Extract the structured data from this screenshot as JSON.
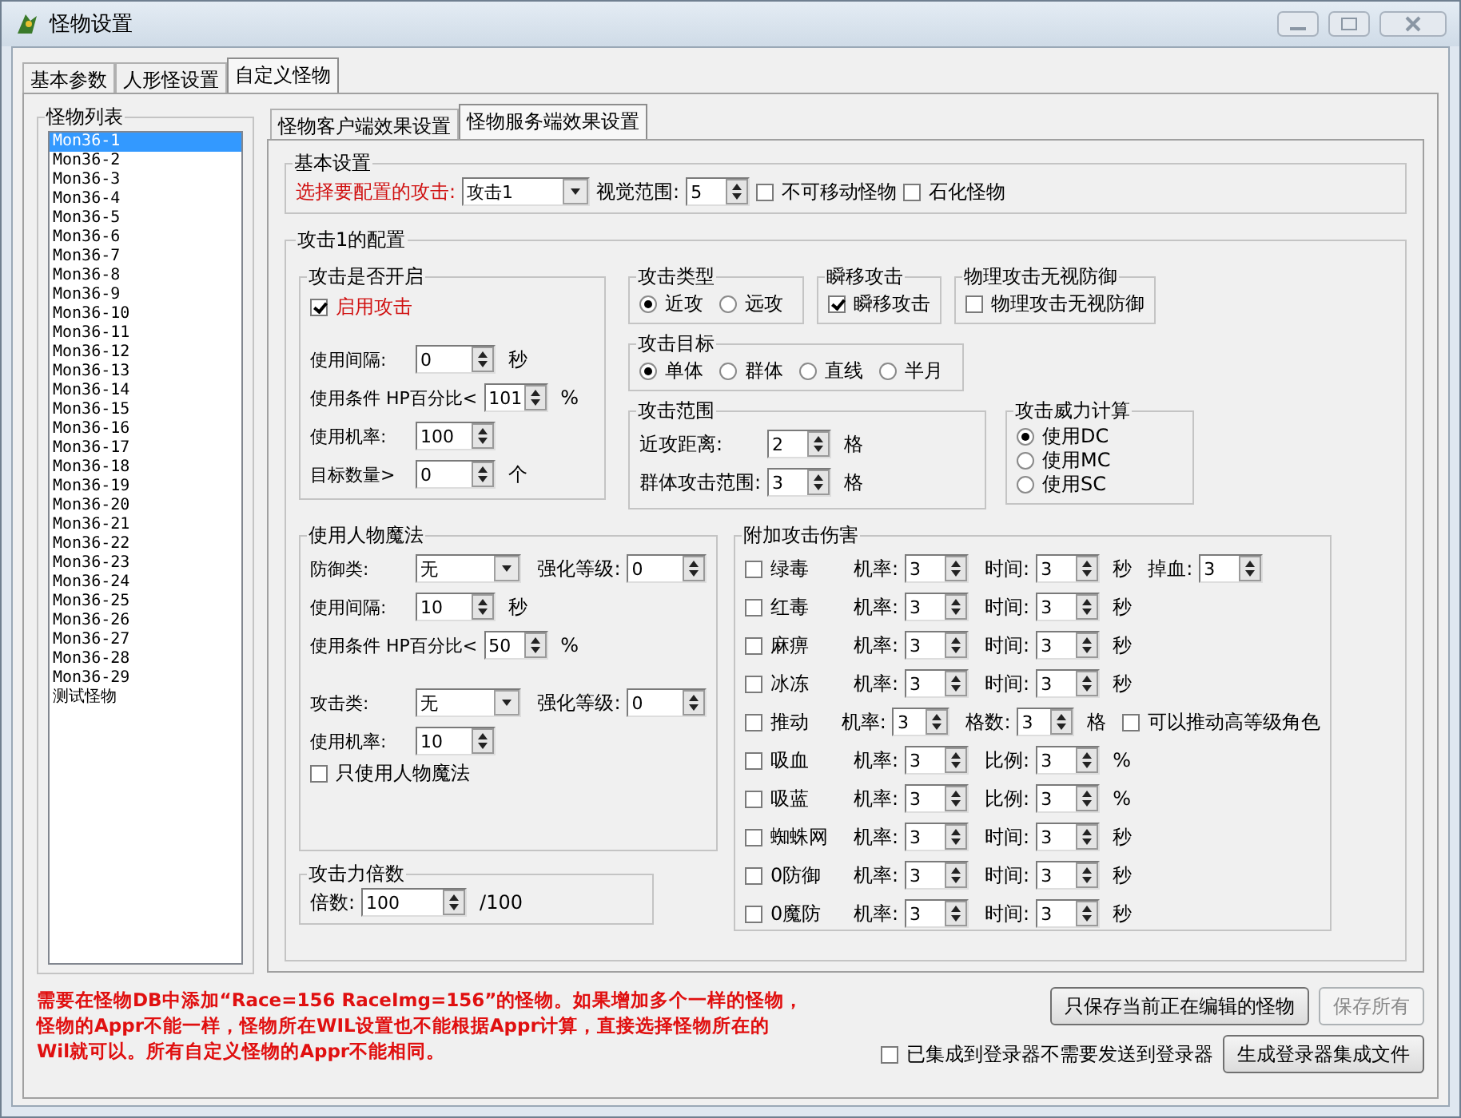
{
  "window": {
    "title": "怪物设置"
  },
  "tabs": [
    {
      "label": "基本参数",
      "selected": false
    },
    {
      "label": "人形怪设置",
      "selected": false
    },
    {
      "label": "自定义怪物",
      "selected": true
    }
  ],
  "monster_list": {
    "title": "怪物列表",
    "items": [
      {
        "label": "Mon36-1",
        "selected": true
      },
      {
        "label": "Mon36-2",
        "selected": false
      },
      {
        "label": "Mon36-3",
        "selected": false
      },
      {
        "label": "Mon36-4",
        "selected": false
      },
      {
        "label": "Mon36-5",
        "selected": false
      },
      {
        "label": "Mon36-6",
        "selected": false
      },
      {
        "label": "Mon36-7",
        "selected": false
      },
      {
        "label": "Mon36-8",
        "selected": false
      },
      {
        "label": "Mon36-9",
        "selected": false
      },
      {
        "label": "Mon36-10",
        "selected": false
      },
      {
        "label": "Mon36-11",
        "selected": false
      },
      {
        "label": "Mon36-12",
        "selected": false
      },
      {
        "label": "Mon36-13",
        "selected": false
      },
      {
        "label": "Mon36-14",
        "selected": false
      },
      {
        "label": "Mon36-15",
        "selected": false
      },
      {
        "label": "Mon36-16",
        "selected": false
      },
      {
        "label": "Mon36-17",
        "selected": false
      },
      {
        "label": "Mon36-18",
        "selected": false
      },
      {
        "label": "Mon36-19",
        "selected": false
      },
      {
        "label": "Mon36-20",
        "selected": false
      },
      {
        "label": "Mon36-21",
        "selected": false
      },
      {
        "label": "Mon36-22",
        "selected": false
      },
      {
        "label": "Mon36-23",
        "selected": false
      },
      {
        "label": "Mon36-24",
        "selected": false
      },
      {
        "label": "Mon36-25",
        "selected": false
      },
      {
        "label": "Mon36-26",
        "selected": false
      },
      {
        "label": "Mon36-27",
        "selected": false
      },
      {
        "label": "Mon36-28",
        "selected": false
      },
      {
        "label": "Mon36-29",
        "selected": false
      },
      {
        "label": "测试怪物",
        "selected": false
      }
    ]
  },
  "sub_tabs": [
    {
      "label": "怪物客户端效果设置",
      "selected": false
    },
    {
      "label": "怪物服务端效果设置",
      "selected": true
    }
  ],
  "basic": {
    "title": "基本设置",
    "attack_label": "选择要配置的攻击:",
    "attack_value": "攻击1",
    "view_label": "视觉范围:",
    "view_value": "5",
    "checks": [
      {
        "label": "不可移动怪物",
        "checked": false
      },
      {
        "label": "石化怪物",
        "checked": false
      }
    ]
  },
  "attack_config": {
    "title": "攻击1的配置",
    "enable": {
      "title": "攻击是否开启",
      "check": {
        "label": "启用攻击",
        "checked": true
      },
      "rows": [
        {
          "kind": "spin",
          "label": "使用间隔:",
          "value": "0",
          "unit": "秒"
        },
        {
          "kind": "percent",
          "label": "使用条件 HP百分比<",
          "value": "101",
          "unit": "%"
        },
        {
          "kind": "spin",
          "label": "使用机率:",
          "value": "100"
        },
        {
          "kind": "spin",
          "label": "目标数量>",
          "value": "0",
          "unit": "个"
        }
      ]
    },
    "attack_type": {
      "title": "攻击类型",
      "options": [
        {
          "label": "近攻",
          "selected": true
        },
        {
          "label": "远攻",
          "selected": false
        }
      ]
    },
    "teleport": {
      "title": "瞬移攻击",
      "check": {
        "label": "瞬移攻击",
        "checked": true
      }
    },
    "ignore_defense": {
      "title": "物理攻击无视防御",
      "check": {
        "label": "物理攻击无视防御",
        "checked": false
      }
    },
    "target": {
      "title": "攻击目标",
      "options": [
        {
          "label": "单体",
          "selected": true
        },
        {
          "label": "群体",
          "selected": false
        },
        {
          "label": "直线",
          "selected": false
        },
        {
          "label": "半月",
          "selected": false
        }
      ]
    },
    "range": {
      "title": "攻击范围",
      "rows": [
        {
          "label": "近攻距离:",
          "value": "2",
          "unit": "格"
        },
        {
          "label": "群体攻击范围:",
          "value": "3",
          "unit": "格"
        }
      ]
    },
    "power": {
      "title": "攻击威力计算",
      "options": [
        {
          "label": "使用DC",
          "selected": true
        },
        {
          "label": "使用MC",
          "selected": false
        },
        {
          "label": "使用SC",
          "selected": false
        }
      ]
    },
    "magic": {
      "title": "使用人物魔法",
      "sections": [
        [
          {
            "kind": "combo",
            "label": "防御类:",
            "value": "无",
            "extra_label": "强化等级:",
            "extra_value": "0"
          },
          {
            "kind": "spin",
            "label": "使用间隔:",
            "value": "10",
            "unit": "秒"
          },
          {
            "kind": "percent",
            "label": "使用条件 HP百分比<",
            "value": "50",
            "unit": "%"
          }
        ],
        [
          {
            "kind": "combo",
            "label": "攻击类:",
            "value": "无",
            "extra_label": "强化等级:",
            "extra_value": "0"
          },
          {
            "kind": "spin",
            "label": "使用机率:",
            "value": "10"
          }
        ]
      ],
      "check": {
        "label": "只使用人物魔法",
        "checked": false
      }
    },
    "multiplier": {
      "title": "攻击力倍数",
      "label": "倍数:",
      "value": "100",
      "unit": "/100"
    },
    "extra_damage": {
      "title": "附加攻击伤害",
      "rows": [
        {
          "label": "绿毒",
          "checked": false,
          "rate_label": "机率:",
          "rate": "3",
          "p_label": "时间:",
          "p": "3",
          "unit": "秒",
          "extra": {
            "kind": "spin",
            "label": "掉血:",
            "value": "3"
          }
        },
        {
          "label": "红毒",
          "checked": false,
          "rate_label": "机率:",
          "rate": "3",
          "p_label": "时间:",
          "p": "3",
          "unit": "秒"
        },
        {
          "label": "麻痹",
          "checked": false,
          "rate_label": "机率:",
          "rate": "3",
          "p_label": "时间:",
          "p": "3",
          "unit": "秒"
        },
        {
          "label": "冰冻",
          "checked": false,
          "rate_label": "机率:",
          "rate": "3",
          "p_label": "时间:",
          "p": "3",
          "unit": "秒"
        },
        {
          "label": "推动",
          "checked": false,
          "rate_label": "机率:",
          "rate": "3",
          "p_label": "格数:",
          "p": "3",
          "unit": "格",
          "extra": {
            "kind": "check",
            "label": "可以推动高等级角色",
            "checked": false
          }
        },
        {
          "label": "吸血",
          "checked": false,
          "rate_label": "机率:",
          "rate": "3",
          "p_label": "比例:",
          "p": "3",
          "unit": "%"
        },
        {
          "label": "吸蓝",
          "checked": false,
          "rate_label": "机率:",
          "rate": "3",
          "p_label": "比例:",
          "p": "3",
          "unit": "%"
        },
        {
          "label": "蜘蛛网",
          "checked": false,
          "rate_label": "机率:",
          "rate": "3",
          "p_label": "时间:",
          "p": "3",
          "unit": "秒"
        },
        {
          "label": "0防御",
          "checked": false,
          "rate_label": "机率:",
          "rate": "3",
          "p_label": "时间:",
          "p": "3",
          "unit": "秒"
        },
        {
          "label": "0魔防",
          "checked": false,
          "rate_label": "机率:",
          "rate": "3",
          "p_label": "时间:",
          "p": "3",
          "unit": "秒"
        }
      ]
    }
  },
  "notice": [
    "需要在怪物DB中添加“Race=156 RaceImg=156”的怪物。如果增加多个一样的怪物，",
    "怪物的Appr不能一样，怪物所在WIL设置也不能根据Appr计算，直接选择怪物所在的",
    "Wil就可以。所有自定义怪物的Appr不能相同。"
  ],
  "buttons": [
    {
      "label": "只保存当前正在编辑的怪物",
      "disabled": false
    },
    {
      "label": "保存所有",
      "disabled": true
    },
    {
      "label": "生成登录器集成文件",
      "disabled": false
    }
  ],
  "integrated": {
    "label": "已集成到登录器不需要发送到登录器",
    "checked": false
  }
}
